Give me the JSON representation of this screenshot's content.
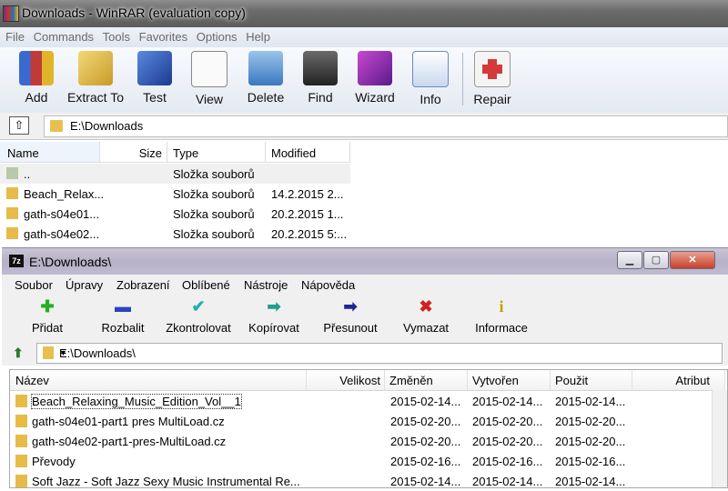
{
  "rar": {
    "title": "Downloads - WinRAR (evaluation copy)",
    "menu": [
      "File",
      "Commands",
      "Tools",
      "Favorites",
      "Options",
      "Help"
    ],
    "toolbar": [
      {
        "label": "Add",
        "icon": "books-add-icon",
        "color": "#8a3a9a"
      },
      {
        "label": "Extract To",
        "icon": "folder-extract-icon",
        "color": "#d9b441"
      },
      {
        "label": "Test",
        "icon": "book-check-icon",
        "color": "#2a55b0"
      },
      {
        "label": "View",
        "icon": "glasses-icon",
        "color": "#f2f2f2"
      },
      {
        "label": "Delete",
        "icon": "recycle-bin-icon",
        "color": "#4a8ad0"
      },
      {
        "label": "Find",
        "icon": "binoculars-icon",
        "color": "#3a3a3a"
      },
      {
        "label": "Wizard",
        "icon": "wizard-wand-icon",
        "color": "#8a3a9a"
      },
      {
        "label": "Info",
        "icon": "info-icon",
        "color": "#3a70c0"
      },
      {
        "label": "Repair",
        "icon": "first-aid-kit-icon",
        "color": "#d43a3a"
      }
    ],
    "path": "E:\\Downloads",
    "columns": {
      "name": "Name",
      "size": "Size",
      "type": "Type",
      "modified": "Modified"
    },
    "rows": [
      {
        "name": "..",
        "size": "",
        "type": "Složka souborů",
        "modified": ""
      },
      {
        "name": "Beach_Relax...",
        "size": "",
        "type": "Složka souborů",
        "modified": "14.2.2015 2..."
      },
      {
        "name": "gath-s04e01...",
        "size": "",
        "type": "Složka souborů",
        "modified": "20.2.2015 1..."
      },
      {
        "name": "gath-s04e02...",
        "size": "",
        "type": "Složka souborů",
        "modified": "20.2.2015 5:..."
      }
    ]
  },
  "sz": {
    "title": "E:\\Downloads\\",
    "logo": "7z",
    "menu": [
      "Soubor",
      "Úpravy",
      "Zobrazení",
      "Oblíbené",
      "Nástroje",
      "Nápověda"
    ],
    "toolbar": [
      {
        "label": "Přidat",
        "icon": "plus-icon",
        "glyph": "+",
        "color": "#22b022"
      },
      {
        "label": "Rozbalit",
        "icon": "minus-icon",
        "glyph": "▬",
        "color": "#2a44c0"
      },
      {
        "label": "Zkontrolovat",
        "icon": "check-icon",
        "glyph": "✔",
        "color": "#22b0b0"
      },
      {
        "label": "Kopírovat",
        "icon": "copy-arrow-icon",
        "glyph": "➡",
        "color": "#22a088"
      },
      {
        "label": "Přesunout",
        "icon": "move-arrow-icon",
        "glyph": "➡",
        "color": "#1a2a90"
      },
      {
        "label": "Vymazat",
        "icon": "delete-x-icon",
        "glyph": "✖",
        "color": "#d02020"
      },
      {
        "label": "Informace",
        "icon": "info-icon",
        "glyph": "i",
        "color": "#c0a000"
      }
    ],
    "path": "E:\\Downloads\\",
    "columns": {
      "name": "Název",
      "size": "Velikost",
      "modified": "Změněn",
      "created": "Vytvořen",
      "accessed": "Použit",
      "attr": "Atribut"
    },
    "rows": [
      {
        "name": "Beach_Relaxing_Music_Edition_Vol__1",
        "modified": "2015-02-14...",
        "created": "2015-02-14...",
        "accessed": "2015-02-14..."
      },
      {
        "name": "gath-s04e01-part1 pres MultiLoad.cz",
        "modified": "2015-02-20...",
        "created": "2015-02-20...",
        "accessed": "2015-02-20..."
      },
      {
        "name": "gath-s04e02-part1-pres-MultiLoad.cz",
        "modified": "2015-02-20...",
        "created": "2015-02-20...",
        "accessed": "2015-02-20..."
      },
      {
        "name": "Převody",
        "modified": "2015-02-16...",
        "created": "2015-02-16...",
        "accessed": "2015-02-16..."
      },
      {
        "name": "Soft Jazz - Soft Jazz Sexy Music Instrumental Re...",
        "modified": "2015-02-14...",
        "created": "2015-02-14...",
        "accessed": "2015-02-14..."
      }
    ]
  }
}
